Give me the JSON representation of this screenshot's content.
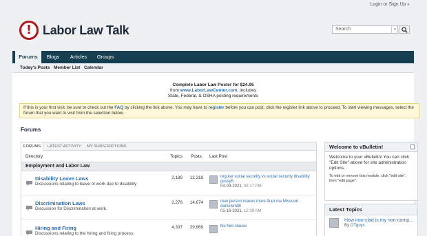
{
  "header": {
    "login_link": "Login or Sign Up",
    "login_caret": "▾",
    "logo_text": "Labor Law Talk",
    "logo_symbol": "!",
    "search_placeholder": "Search"
  },
  "nav": {
    "tabs": [
      "Forums",
      "Blogs",
      "Articles",
      "Groups"
    ],
    "active_tab": "Forums",
    "subnav": [
      "Today's Posts",
      "Member List",
      "Calendar"
    ]
  },
  "promo": {
    "line1": "Complete Labor Law Poster for $24.95",
    "line2_prefix": "from ",
    "line2_link": "www.LaborLawCenter.com",
    "line2_suffix": ", includes",
    "line3": "State, Federal, & OSHA posting requirements"
  },
  "notice": {
    "part1": "If this is your first visit, be sure to check out the ",
    "faq": "FAQ",
    "part2": " by clicking the link above. You may have to ",
    "register": "register",
    "part3": " before you can post: click the register link above to proceed. To start viewing messages, select the forum that you want to visit from the selection below."
  },
  "forums": {
    "section_title": "Forums",
    "tabs": [
      "Forums",
      "Latest Activity",
      "My Subscriptions"
    ],
    "columns": {
      "directory": "Directory",
      "topics": "Topics",
      "posts": "Posts",
      "last_post": "Last Post"
    },
    "group_title": "Employment and Labor Law",
    "rows": [
      {
        "title": "Disability Leave Laws",
        "description": "Discussions relating to leave of work due to disability",
        "topics": "2,189",
        "posts": "12,318",
        "last_post_title": "regular social security vs social security disability",
        "last_post_user": "gussy5",
        "last_post_date": "04-09-2021,",
        "last_post_time": "06:17 PM"
      },
      {
        "title": "Discrimination Laws",
        "description": "Discussion for Discrimination at work.",
        "topics": "2,276",
        "posts": "14,674",
        "last_post_title": "new person makes more than me Missouri",
        "last_post_user": "danielsmith",
        "last_post_date": "01-18-2021,",
        "last_post_time": "12:39 AM"
      },
      {
        "title": "Hiring and Firing",
        "description": "Discussions relating to the hiring and firing process.",
        "topics": "4,337",
        "posts": "29,869",
        "last_post_title": "No hire clause",
        "last_post_user": "",
        "last_post_date": "",
        "last_post_time": ""
      }
    ]
  },
  "sidebar": {
    "welcome_title": "Welcome to vBulletin!",
    "welcome_body": "Welcome to your vBulletin! You can click \"Edit Site\" above for site administration options.",
    "welcome_small": "To edit or remove this module, click \"edit site\", then \"edit page\".",
    "latest_title": "Latest Topics",
    "latest_topics": [
      {
        "title": "How iron-clad is my non-comp...",
        "by": "By ",
        "user": "OTguys"
      }
    ]
  },
  "colors": {
    "nav_bg": "#153e50",
    "link": "#2a6eb0",
    "logo_red": "#b0161b",
    "notice_bg": "#fef8d8"
  }
}
